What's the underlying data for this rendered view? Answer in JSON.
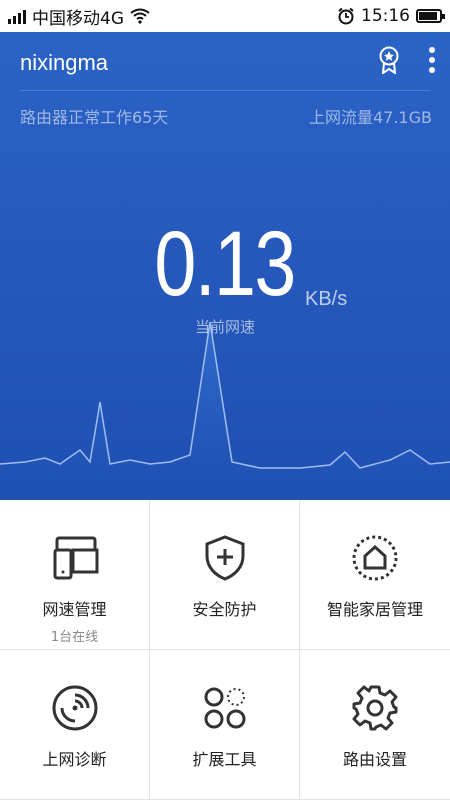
{
  "status_bar": {
    "carrier": "中国移动4G",
    "time": "15:16"
  },
  "header": {
    "title": "nixingma",
    "uptime": "路由器正常工作65天",
    "traffic": "上网流量47.1GB"
  },
  "speed": {
    "value": "0.13",
    "unit": "KB/s",
    "label": "当前网速"
  },
  "menu": [
    {
      "label": "网速管理",
      "sub": "1台在线",
      "icon": "devices-icon"
    },
    {
      "label": "安全防护",
      "sub": "",
      "icon": "shield-plus-icon"
    },
    {
      "label": "智能家居管理",
      "sub": "",
      "icon": "smart-home-icon"
    },
    {
      "label": "上网诊断",
      "sub": "",
      "icon": "diagnosis-icon"
    },
    {
      "label": "扩展工具",
      "sub": "",
      "icon": "tools-icon"
    },
    {
      "label": "路由设置",
      "sub": "",
      "icon": "gear-icon"
    }
  ],
  "colors": {
    "hero_blue": "#2759bc",
    "text_dark": "#222222",
    "text_muted": "#888888"
  }
}
